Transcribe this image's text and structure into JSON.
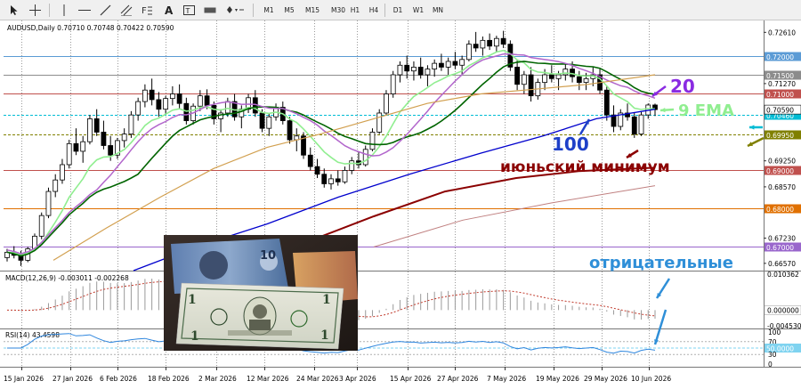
{
  "toolbar": {
    "timeframes": [
      "M1",
      "M5",
      "M15",
      "M30",
      "H1",
      "H4",
      "D1",
      "W1",
      "MN"
    ],
    "tools": [
      "cursor-icon",
      "crosshair-icon",
      "vertical-line-icon",
      "horizontal-line-icon",
      "trendline-icon",
      "channel-icon",
      "fibonacci-icon",
      "text-icon",
      "text-label-icon",
      "rectangle-icon",
      "arrow-icon"
    ]
  },
  "main_header": "AUDUSD,Daily  0.70710 0.70748 0.70422 0.70590",
  "macd_header": "MACD(12,26,9) -0.003011 -0.002268",
  "rsi_header": "RSI(14) 43.4598",
  "annotations": {
    "ma20": "20",
    "ema9": "9 EMA",
    "ma100": "100",
    "june_low": "июньский минимум",
    "negative": "отрицательные"
  },
  "colors": {
    "ema9": "#90ee90",
    "ma20": "#006400",
    "ma_violet": "#b266cc",
    "ma100": "#0000cd",
    "ma200": "#8b0000",
    "ma_tan": "#d2a050",
    "arrow_purple": "#8a2be2",
    "arrow_dark_red": "#8b0000",
    "arrow_blue": "#1e40c8",
    "arrow_cyan": "#00bcd4",
    "arrow_olive": "#808000",
    "text_negative": "#2f8fd8"
  },
  "photo": {
    "content": "dollar-banknotes",
    "note_value": "10"
  },
  "chart_data": {
    "type": "candlestick",
    "symbol": "AUDUSD",
    "timeframe": "Daily",
    "ohlc_last": {
      "open": 0.7071,
      "high": 0.70748,
      "low": 0.70422,
      "close": 0.7059
    },
    "price_axis": {
      "ticks": [
        "0.72610",
        "0.72000",
        "0.71500",
        "0.71270",
        "0.71000",
        "0.70590",
        "0.70460",
        "0.69950",
        "0.69250",
        "0.69000",
        "0.68570",
        "0.68000",
        "0.67230",
        "0.67000",
        "0.66570"
      ],
      "range": [
        0.6638,
        0.7292
      ]
    },
    "horizontal_levels": [
      {
        "price": 0.72,
        "color": "#5b9bd5",
        "label": "0.72000"
      },
      {
        "price": 0.715,
        "color": "#8c8c8c",
        "label": "0.71500"
      },
      {
        "price": 0.71,
        "color": "#c0504d",
        "label": "0.71000"
      },
      {
        "price": 0.7046,
        "color": "#00bcd4",
        "label": "0.70460",
        "dashed": true
      },
      {
        "price": 0.6995,
        "color": "#808000",
        "label": "0.69950",
        "dashed": true
      },
      {
        "price": 0.69,
        "color": "#c0504d",
        "label": "0.69000"
      },
      {
        "price": 0.68,
        "color": "#e07000",
        "label": "0.68000"
      },
      {
        "price": 0.67,
        "color": "#9966cc",
        "label": "0.67000"
      }
    ],
    "current_price": "0.70590",
    "macd_axis": [
      "0.010362",
      "0.000000",
      "-0.004530"
    ],
    "macd_range": [
      -0.00453,
      0.010362
    ],
    "rsi_axis": [
      "100",
      "70",
      "50.0000",
      "30",
      "0"
    ],
    "rsi_current": 43.4598,
    "date_ticks": [
      "15 Jan 2026",
      "27 Jan 2026",
      "6 Feb 2026",
      "18 Feb 2026",
      "2 Mar 2026",
      "12 Mar 2026",
      "24 Mar 2026",
      "3 Apr 2026",
      "15 Apr 2026",
      "27 Apr 2026",
      "7 May 2026",
      "19 May 2026",
      "29 May 2026",
      "10 Jun 2026"
    ],
    "candles": [
      [
        0.6672,
        0.6695,
        0.6662,
        0.6686
      ],
      [
        0.6686,
        0.6702,
        0.667,
        0.6678
      ],
      [
        0.6678,
        0.669,
        0.665,
        0.6665
      ],
      [
        0.6665,
        0.67,
        0.666,
        0.6695
      ],
      [
        0.6695,
        0.6735,
        0.669,
        0.6728
      ],
      [
        0.6728,
        0.679,
        0.672,
        0.6782
      ],
      [
        0.6782,
        0.6855,
        0.6775,
        0.6845
      ],
      [
        0.6845,
        0.689,
        0.683,
        0.6875
      ],
      [
        0.6875,
        0.693,
        0.6865,
        0.6915
      ],
      [
        0.6915,
        0.698,
        0.6905,
        0.697
      ],
      [
        0.697,
        0.701,
        0.694,
        0.695
      ],
      [
        0.695,
        0.699,
        0.692,
        0.6975
      ],
      [
        0.6975,
        0.7045,
        0.6968,
        0.7035
      ],
      [
        0.7035,
        0.706,
        0.699,
        0.7
      ],
      [
        0.7,
        0.703,
        0.6955,
        0.6965
      ],
      [
        0.6965,
        0.699,
        0.6925,
        0.694
      ],
      [
        0.694,
        0.6985,
        0.693,
        0.6978
      ],
      [
        0.6978,
        0.701,
        0.696,
        0.6995
      ],
      [
        0.6995,
        0.7055,
        0.6985,
        0.7045
      ],
      [
        0.7045,
        0.709,
        0.703,
        0.708
      ],
      [
        0.708,
        0.7125,
        0.7065,
        0.711
      ],
      [
        0.711,
        0.714,
        0.707,
        0.7085
      ],
      [
        0.7085,
        0.7105,
        0.704,
        0.706
      ],
      [
        0.706,
        0.7095,
        0.7045,
        0.7088
      ],
      [
        0.7088,
        0.712,
        0.707,
        0.71
      ],
      [
        0.71,
        0.7125,
        0.706,
        0.7075
      ],
      [
        0.7075,
        0.709,
        0.702,
        0.703
      ],
      [
        0.703,
        0.7075,
        0.702,
        0.7068
      ],
      [
        0.7068,
        0.711,
        0.7055,
        0.7095
      ],
      [
        0.7095,
        0.7112,
        0.706,
        0.707
      ],
      [
        0.707,
        0.708,
        0.702,
        0.7035
      ],
      [
        0.7035,
        0.706,
        0.7,
        0.705
      ],
      [
        0.705,
        0.709,
        0.704,
        0.708
      ],
      [
        0.708,
        0.71,
        0.703,
        0.704
      ],
      [
        0.704,
        0.707,
        0.701,
        0.706
      ],
      [
        0.706,
        0.71,
        0.705,
        0.709
      ],
      [
        0.709,
        0.711,
        0.704,
        0.705
      ],
      [
        0.705,
        0.706,
        0.7,
        0.701
      ],
      [
        0.701,
        0.705,
        0.699,
        0.704
      ],
      [
        0.704,
        0.7075,
        0.703,
        0.7065
      ],
      [
        0.7065,
        0.708,
        0.702,
        0.703
      ],
      [
        0.703,
        0.704,
        0.697,
        0.698
      ],
      [
        0.698,
        0.701,
        0.695,
        0.699
      ],
      [
        0.699,
        0.7,
        0.693,
        0.694
      ],
      [
        0.694,
        0.696,
        0.69,
        0.691
      ],
      [
        0.691,
        0.693,
        0.688,
        0.689
      ],
      [
        0.689,
        0.6905,
        0.6855,
        0.6865
      ],
      [
        0.6865,
        0.689,
        0.685,
        0.6878
      ],
      [
        0.6878,
        0.69,
        0.686,
        0.687
      ],
      [
        0.687,
        0.691,
        0.6865,
        0.69
      ],
      [
        0.69,
        0.6935,
        0.689,
        0.6925
      ],
      [
        0.6925,
        0.695,
        0.6905,
        0.6915
      ],
      [
        0.6915,
        0.6965,
        0.691,
        0.6955
      ],
      [
        0.6955,
        0.701,
        0.695,
        0.7
      ],
      [
        0.7,
        0.706,
        0.6995,
        0.705
      ],
      [
        0.705,
        0.711,
        0.7045,
        0.71
      ],
      [
        0.71,
        0.716,
        0.709,
        0.715
      ],
      [
        0.715,
        0.7185,
        0.713,
        0.7175
      ],
      [
        0.7175,
        0.72,
        0.714,
        0.716
      ],
      [
        0.716,
        0.7185,
        0.7135,
        0.717
      ],
      [
        0.717,
        0.7195,
        0.714,
        0.715
      ],
      [
        0.715,
        0.7175,
        0.712,
        0.7165
      ],
      [
        0.7165,
        0.719,
        0.7145,
        0.718
      ],
      [
        0.718,
        0.7205,
        0.716,
        0.717
      ],
      [
        0.717,
        0.7195,
        0.715,
        0.7185
      ],
      [
        0.7185,
        0.721,
        0.7165,
        0.7175
      ],
      [
        0.7175,
        0.72,
        0.715,
        0.719
      ],
      [
        0.719,
        0.724,
        0.7185,
        0.723
      ],
      [
        0.723,
        0.7262,
        0.721,
        0.722
      ],
      [
        0.722,
        0.725,
        0.72,
        0.724
      ],
      [
        0.724,
        0.7258,
        0.7215,
        0.7225
      ],
      [
        0.7225,
        0.7252,
        0.721,
        0.7245
      ],
      [
        0.7245,
        0.7265,
        0.722,
        0.723
      ],
      [
        0.723,
        0.724,
        0.716,
        0.717
      ],
      [
        0.717,
        0.719,
        0.711,
        0.7125
      ],
      [
        0.7125,
        0.716,
        0.71,
        0.715
      ],
      [
        0.715,
        0.717,
        0.708,
        0.7095
      ],
      [
        0.7095,
        0.714,
        0.7085,
        0.713
      ],
      [
        0.713,
        0.7165,
        0.711,
        0.715
      ],
      [
        0.715,
        0.7175,
        0.713,
        0.714
      ],
      [
        0.714,
        0.716,
        0.711,
        0.715
      ],
      [
        0.715,
        0.718,
        0.7135,
        0.7165
      ],
      [
        0.7165,
        0.7185,
        0.713,
        0.7145
      ],
      [
        0.7145,
        0.716,
        0.711,
        0.713
      ],
      [
        0.713,
        0.7155,
        0.711,
        0.714
      ],
      [
        0.714,
        0.717,
        0.712,
        0.715
      ],
      [
        0.715,
        0.7165,
        0.71,
        0.711
      ],
      [
        0.711,
        0.712,
        0.703,
        0.7045
      ],
      [
        0.7045,
        0.707,
        0.7,
        0.7015
      ],
      [
        0.7015,
        0.706,
        0.7005,
        0.705
      ],
      [
        0.705,
        0.7075,
        0.703,
        0.704
      ],
      [
        0.704,
        0.705,
        0.6985,
        0.6995
      ],
      [
        0.6995,
        0.7055,
        0.699,
        0.7045
      ],
      [
        0.7045,
        0.7075,
        0.7035,
        0.7071
      ],
      [
        0.7071,
        0.70748,
        0.70422,
        0.7059
      ]
    ],
    "macd_signal_visible": true
  }
}
